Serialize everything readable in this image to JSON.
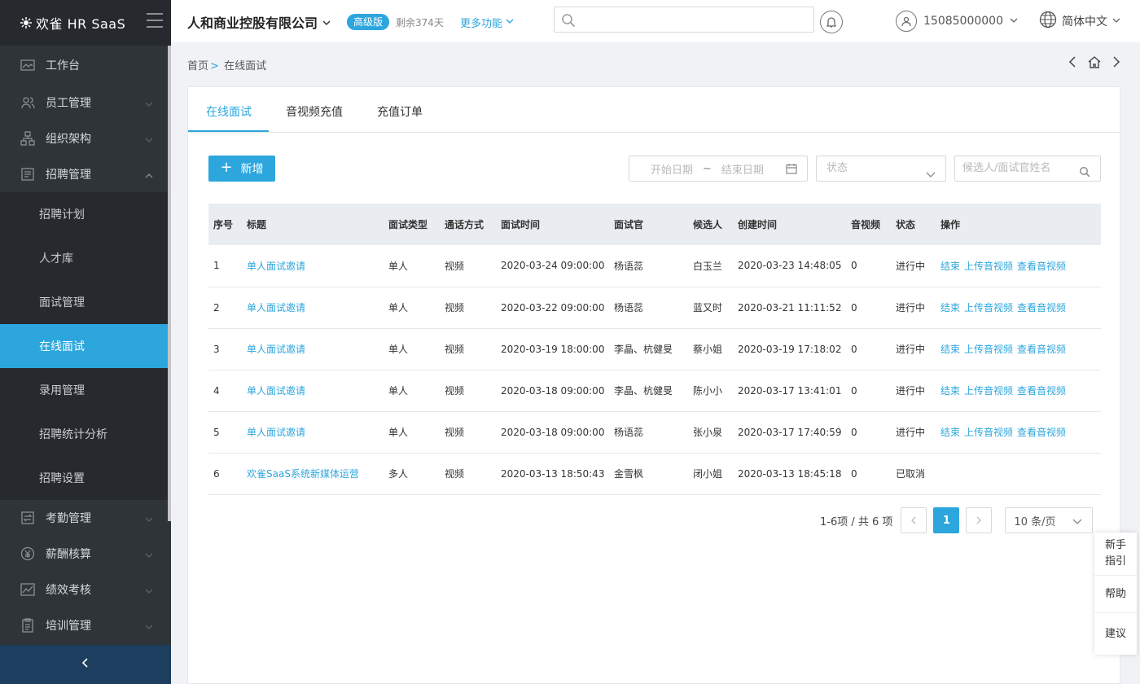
{
  "app": {
    "brand": "欢雀 HR SaaS",
    "collapse_icon": "chevron-left-icon"
  },
  "sidebar": {
    "top_item": {
      "label": "工作台",
      "icon": "dashboard-icon"
    },
    "groups": [
      {
        "label": "员工管理",
        "icon": "users-icon"
      },
      {
        "label": "组织架构",
        "icon": "org-chart-icon"
      },
      {
        "label": "招聘管理",
        "icon": "recruit-icon",
        "expanded": true
      }
    ],
    "sub_items": [
      {
        "label": "招聘计划"
      },
      {
        "label": "人才库"
      },
      {
        "label": "面试管理"
      },
      {
        "label": "在线面试",
        "active": true
      },
      {
        "label": "录用管理"
      },
      {
        "label": "招聘统计分析"
      },
      {
        "label": "招聘设置"
      }
    ],
    "bottom_groups": [
      {
        "label": "考勤管理",
        "icon": "attendance-icon"
      },
      {
        "label": "薪酬核算",
        "icon": "salary-icon"
      },
      {
        "label": "绩效考核",
        "icon": "performance-icon"
      },
      {
        "label": "培训管理",
        "icon": "training-icon"
      }
    ]
  },
  "header": {
    "company": "人和商业控股有限公司",
    "badge": "高级版",
    "remaining": "剩余374天",
    "more": "更多功能",
    "search_placeholder": "",
    "phone": "15085000000",
    "language": "简体中文"
  },
  "breadcrumb": {
    "home": "首页",
    "sep": ">",
    "current": "在线面试"
  },
  "tabs": [
    {
      "label": "在线面试",
      "active": true
    },
    {
      "label": "音视频充值"
    },
    {
      "label": "充值订单"
    }
  ],
  "toolbar": {
    "add_label": "新增",
    "start_date_placeholder": "开始日期",
    "range_sep": "~",
    "end_date_placeholder": "结束日期",
    "status_placeholder": "状态",
    "search_placeholder": "候选人/面试官姓名"
  },
  "table": {
    "columns": [
      "序号",
      "标题",
      "面试类型",
      "通话方式",
      "面试时间",
      "面试官",
      "候选人",
      "创建时间",
      "音视频",
      "状态",
      "操作"
    ],
    "rows": [
      {
        "no": "1",
        "title": "单人面试邀请",
        "type": "单人",
        "call": "视频",
        "time": "2020-03-24 09:00:00",
        "interviewer": "杨语蕊",
        "candidate": "白玉兰",
        "created": "2020-03-23 14:48:05",
        "av": "0",
        "status": "进行中",
        "ops": [
          "结束",
          "上传音视频",
          "查看音视频"
        ]
      },
      {
        "no": "2",
        "title": "单人面试邀请",
        "type": "单人",
        "call": "视频",
        "time": "2020-03-22 09:00:00",
        "interviewer": "杨语蕊",
        "candidate": "蓝又时",
        "created": "2020-03-21 11:11:52",
        "av": "0",
        "status": "进行中",
        "ops": [
          "结束",
          "上传音视频",
          "查看音视频"
        ]
      },
      {
        "no": "3",
        "title": "单人面试邀请",
        "type": "单人",
        "call": "视频",
        "time": "2020-03-19 18:00:00",
        "interviewer": "李晶、杭健旻",
        "candidate": "蔡小姐",
        "created": "2020-03-19 17:18:02",
        "av": "0",
        "status": "进行中",
        "ops": [
          "结束",
          "上传音视频",
          "查看音视频"
        ]
      },
      {
        "no": "4",
        "title": "单人面试邀请",
        "type": "单人",
        "call": "视频",
        "time": "2020-03-18 09:00:00",
        "interviewer": "李晶、杭健旻",
        "candidate": "陈小小",
        "created": "2020-03-17 13:41:01",
        "av": "0",
        "status": "进行中",
        "ops": [
          "结束",
          "上传音视频",
          "查看音视频"
        ]
      },
      {
        "no": "5",
        "title": "单人面试邀请",
        "type": "单人",
        "call": "视频",
        "time": "2020-03-18 09:00:00",
        "interviewer": "杨语蕊",
        "candidate": "张小泉",
        "created": "2020-03-17 17:40:59",
        "av": "0",
        "status": "进行中",
        "ops": [
          "结束",
          "上传音视频",
          "查看音视频"
        ]
      },
      {
        "no": "6",
        "title": "欢雀SaaS系统新媒体运营",
        "type": "多人",
        "call": "视频",
        "time": "2020-03-13 18:50:43",
        "interviewer": "金雪枫",
        "candidate": "闭小姐",
        "created": "2020-03-13 18:45:18",
        "av": "0",
        "status": "已取消",
        "ops": []
      }
    ]
  },
  "pagination": {
    "summary": "1-6项 / 共 6 项",
    "current": "1",
    "page_size": "10 条/页"
  },
  "float_panel": {
    "guide": "新手指引",
    "guide_line1": "新手",
    "guide_line2": "指引",
    "help": "帮助",
    "suggest": "建议"
  },
  "colors": {
    "accent": "#2ca6dd",
    "sidebar_bg": "#2f3438",
    "sidebar_dark": "#262a2e",
    "footer_bg": "#1d3e5e"
  }
}
